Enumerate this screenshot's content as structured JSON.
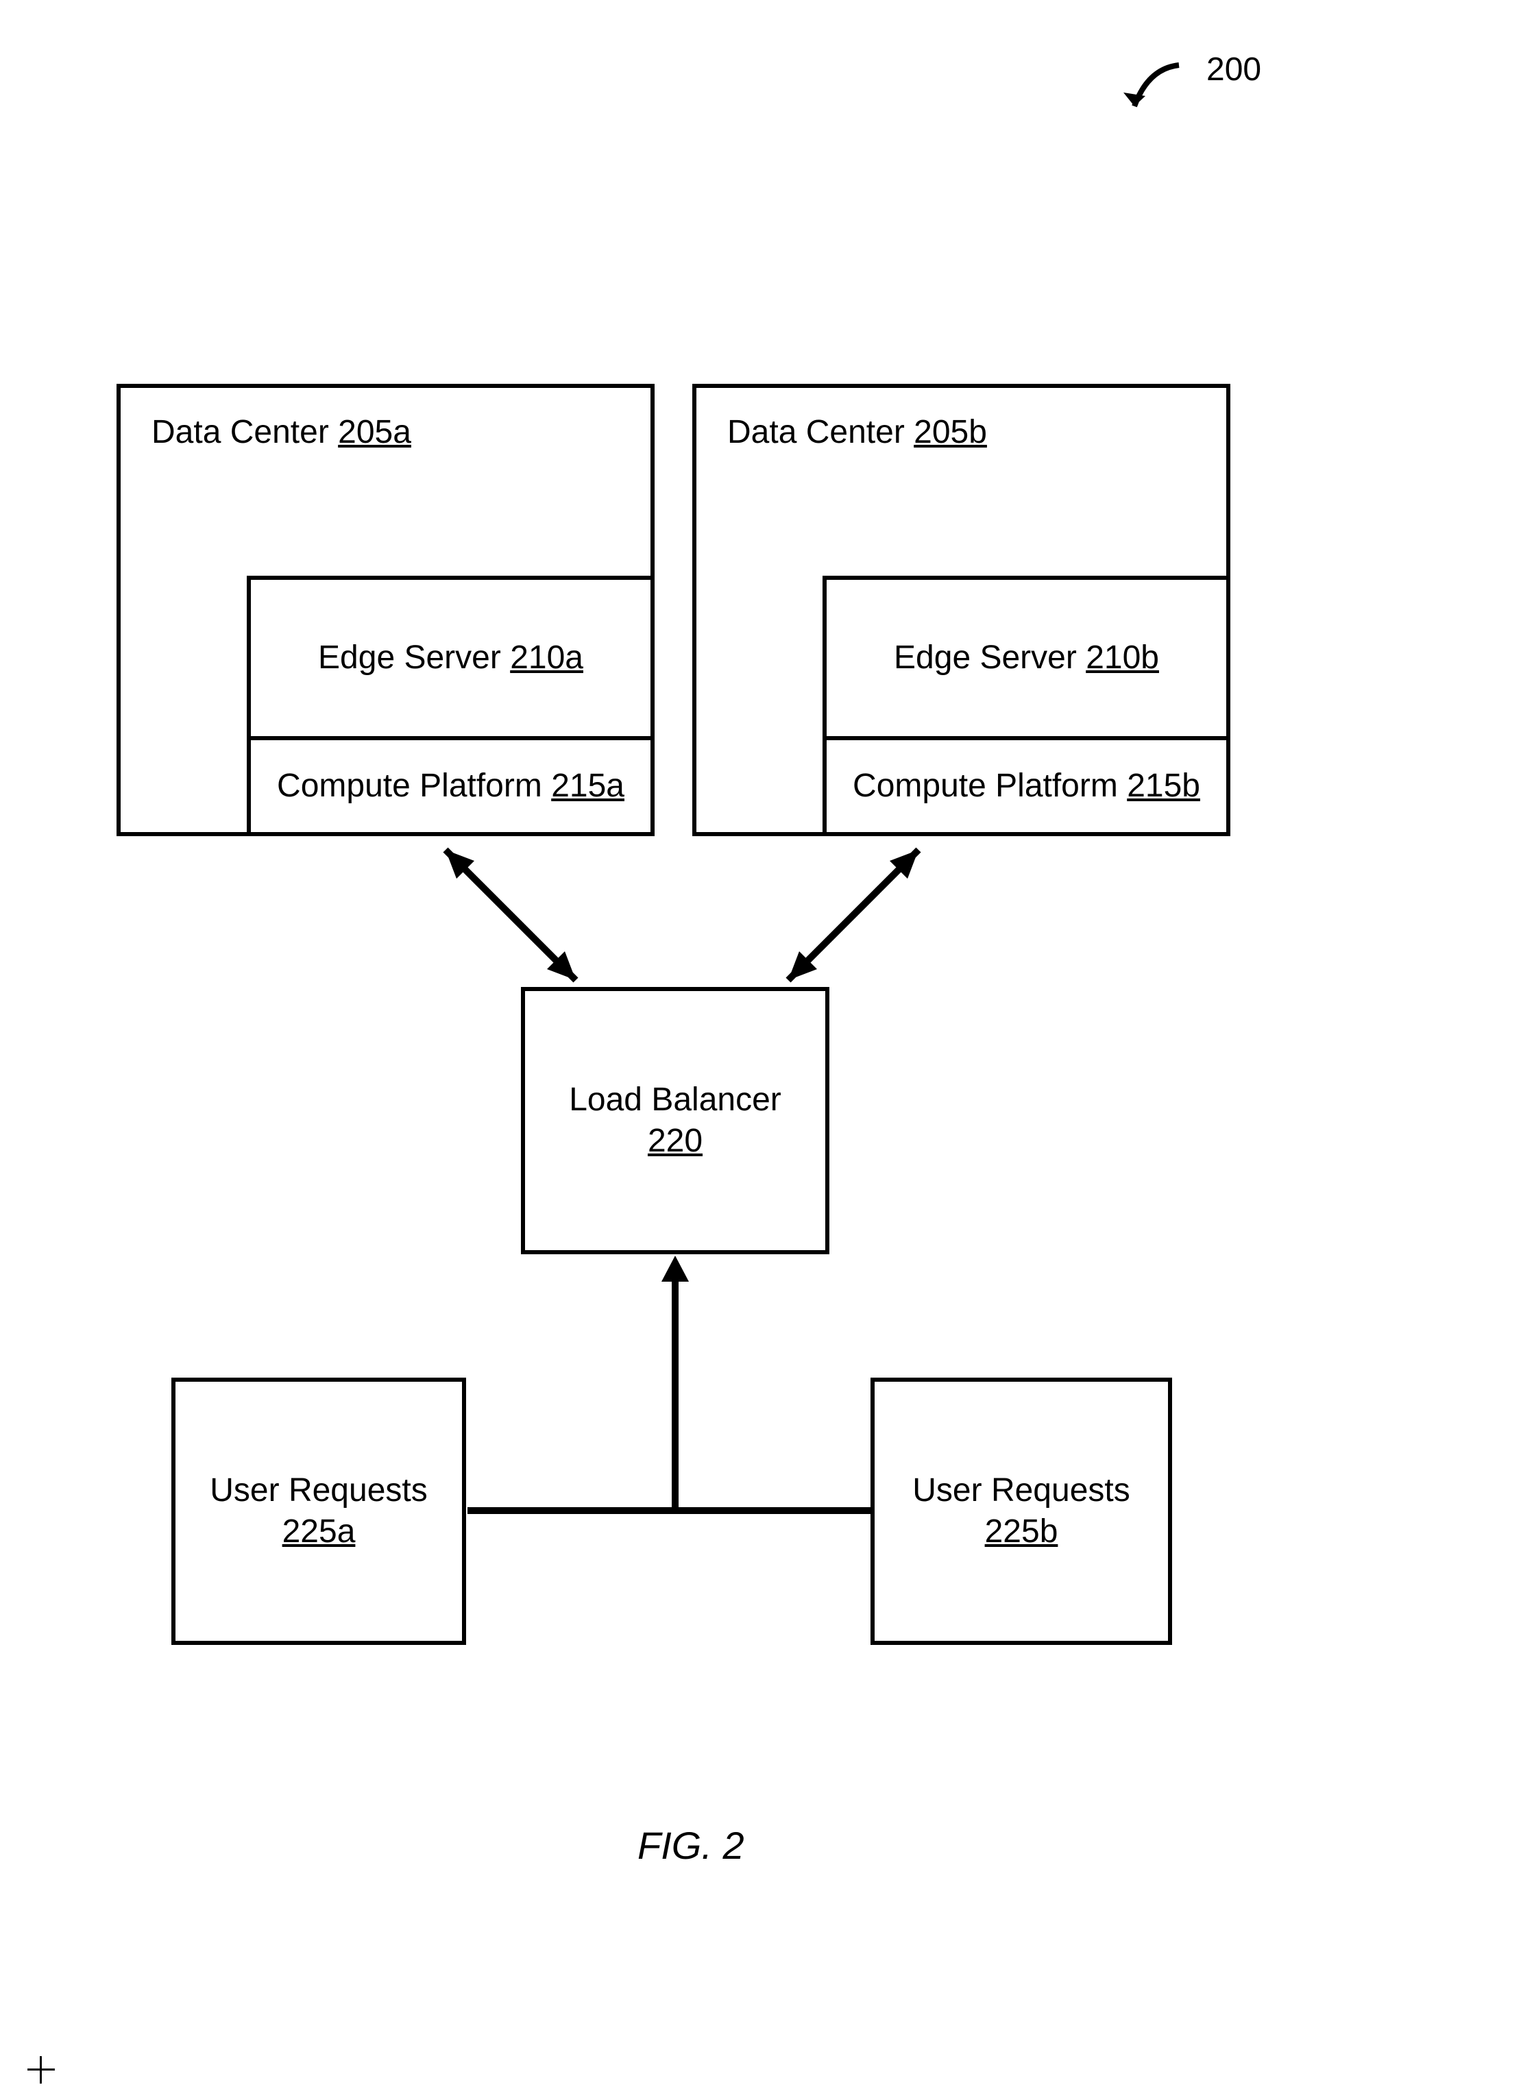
{
  "figure_ref": "200",
  "caption": "FIG. 2",
  "data_center_a": {
    "title_prefix": "Data Center ",
    "ref": "205a",
    "edge_server": {
      "title_prefix": "Edge Server ",
      "ref": "210a"
    },
    "compute_platform": {
      "title_prefix": "Compute Platform ",
      "ref": "215a"
    }
  },
  "data_center_b": {
    "title_prefix": "Data Center ",
    "ref": "205b",
    "edge_server": {
      "title_prefix": "Edge Server ",
      "ref": "210b"
    },
    "compute_platform": {
      "title_prefix": "Compute Platform ",
      "ref": "215b"
    }
  },
  "load_balancer": {
    "title": "Load Balancer",
    "ref": "220"
  },
  "user_requests_a": {
    "title": "User Requests",
    "ref": "225a"
  },
  "user_requests_b": {
    "title": "User Requests",
    "ref": "225b"
  }
}
